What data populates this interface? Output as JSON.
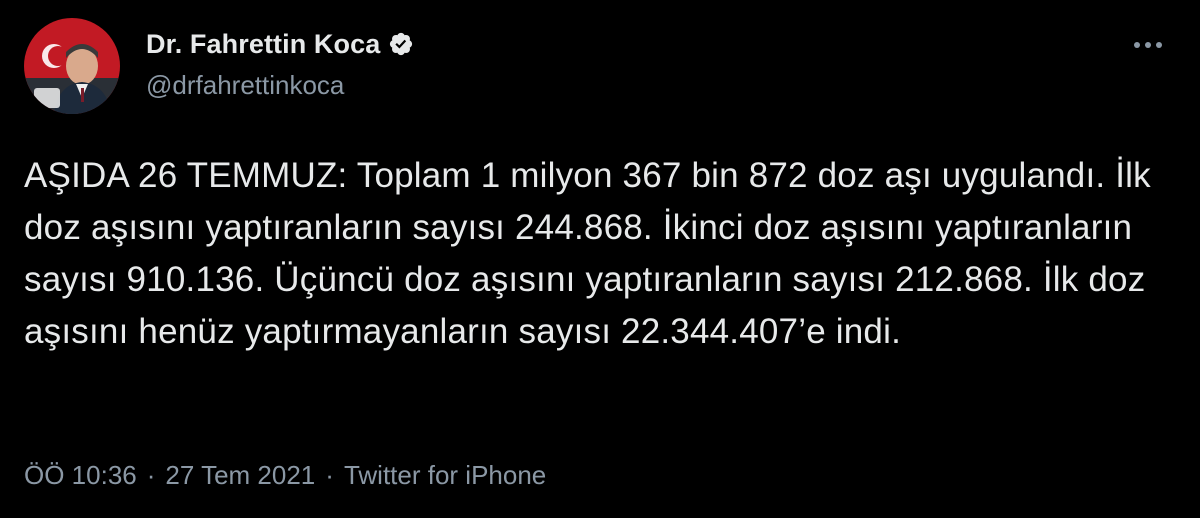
{
  "author": {
    "name": "Dr. Fahrettin Koca",
    "handle": "@drfahrettinkoca",
    "verified": true
  },
  "tweet": {
    "text": "AŞIDA 26 TEMMUZ: Toplam 1 milyon 367 bin 872 doz aşı uygulandı. İlk doz aşısını yaptıranların sayısı 244.868. İkinci doz aşısını yaptıranların sayısı 910.136. Üçüncü doz aşısını yaptıranların sayısı 212.868. İlk doz aşısını henüz yaptırmayanların sayısı 22.344.407’e indi."
  },
  "meta": {
    "time": "ÖÖ 10:36",
    "separator": "·",
    "date": "27 Tem 2021",
    "source": "Twitter for iPhone"
  },
  "colors": {
    "background": "#000000",
    "text": "#e7e9ea",
    "secondary": "#8b98a5",
    "verified_badge": "#e7e9ea"
  },
  "icons": {
    "verified": "verified-badge-icon",
    "more": "more-horizontal-icon"
  }
}
